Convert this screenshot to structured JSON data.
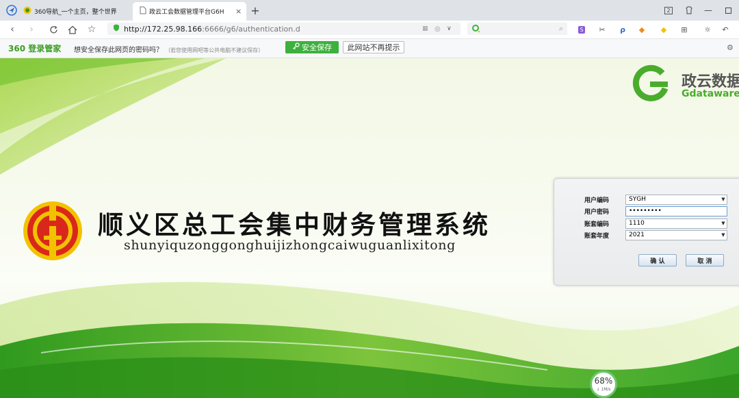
{
  "tabs": [
    {
      "label": "360导航_一个主页，整个世界",
      "active": false,
      "icon": "360-browser-icon"
    },
    {
      "label": "政云工会数据管理平台G6H",
      "active": true,
      "icon": "page-icon"
    }
  ],
  "window_controls": {
    "tab_count": "2"
  },
  "address": {
    "host": "http://172.25.98.166",
    "path": ":6666/g6/authentication.d"
  },
  "infobar": {
    "logo_text": "360 登录管家",
    "message": "想安全保存此网页的密码吗？",
    "note": "（若您使用网吧等公共电脑不建议保存）",
    "save_label": "安全保存",
    "never_label": "此网站不再提示"
  },
  "brand": {
    "name_cn": "政云数据",
    "name_en": "Gdataware"
  },
  "system": {
    "title_cn": "顺义区总工会集中财务管理系统",
    "title_pinyin": "shunyiquzonggonghuijizhongcaiwuguanlixitong"
  },
  "login": {
    "user_code_label": "用户编码",
    "user_code_value": "SYGH",
    "password_label": "用户密码",
    "password_value": "•••••••••",
    "account_code_label": "账套编码",
    "account_code_value": "1110",
    "account_year_label": "账套年度",
    "account_year_value": "2021",
    "confirm_label": "确 认",
    "cancel_label": "取 消"
  },
  "speed_widget": {
    "percent": "68%",
    "rate": "↓ 1M/s"
  },
  "colors": {
    "brand_green": "#4aac2c",
    "save_green": "#3db13d",
    "union_red": "#d9281b",
    "union_gold": "#f2c200"
  }
}
